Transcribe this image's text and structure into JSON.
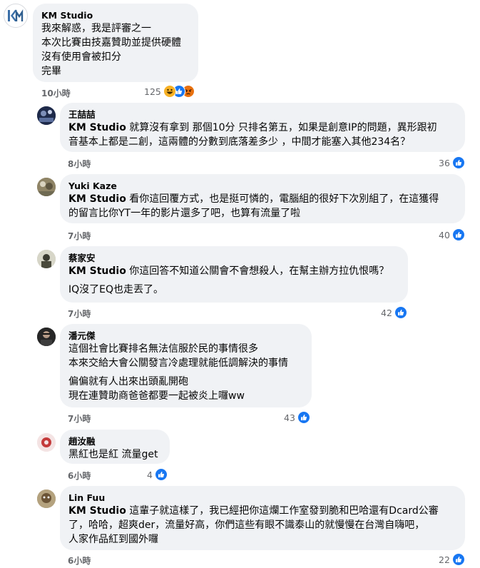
{
  "comments": [
    {
      "author": "KM Studio",
      "text_lines": [
        "我來解惑，我是評審之一",
        "本次比賽由技嘉贊助並提供硬體",
        "沒有使用會被扣分",
        "完畢"
      ],
      "time": "10小時",
      "reaction_count": "125",
      "reactions": [
        "haha-icon",
        "like-icon",
        "angry-icon"
      ]
    },
    {
      "author": "王喆喆",
      "mention": "KM Studio",
      "text_lines": [
        " 就算沒有拿到 那個10分 只排名第五，如果是創意IP的問題，異形跟初",
        "音基本上都是二創，這兩體的分數到底落差多少 ，中間才能塞入其他234名？"
      ],
      "time": "8小時",
      "reaction_count": "36",
      "reactions": [
        "like-icon"
      ]
    },
    {
      "author": "Yuki Kaze",
      "mention": "KM Studio",
      "text_lines": [
        " 看你這回覆方式，也是挺可憐的，電腦組的很好下次別組了，在這獲得",
        "的留言比你YT一年的影片還多了吧，也算有流量了啦"
      ],
      "time": "7小時",
      "reaction_count": "40",
      "reactions": [
        "like-icon"
      ]
    },
    {
      "author": "蔡家安",
      "mention": "KM Studio",
      "text_lines": [
        " 你這回答不知道公關會不會想殺人，在幫主辦方拉仇恨嗎？",
        "IQ沒了EQ也走丟了。"
      ],
      "time": "7小時",
      "reaction_count": "42",
      "reactions": [
        "like-icon"
      ]
    },
    {
      "author": "潘元傑",
      "text_lines": [
        "這個社會比賽排名無法信服於民的事情很多",
        "本來交給大會公關發言冷處理就能低調解決的事情",
        "偏偏就有人出來出頭亂開砲",
        "現在連贊助商爸爸都要一起被炎上囉ww"
      ],
      "time": "7小時",
      "reaction_count": "43",
      "reactions": [
        "like-icon"
      ]
    },
    {
      "author": "趙汝融",
      "text_lines": [
        "黑紅也是紅 流量get"
      ],
      "time": "6小時",
      "reaction_count": "4",
      "reactions": [
        "like-icon"
      ]
    },
    {
      "author": "Lin Fuu",
      "mention": "KM Studio",
      "text_lines": [
        " 這輩子就這樣了，我已經把你這爛工作室發到脆和巴哈還有Dcard公審",
        "了，哈哈，超爽der，流量好高，你們這些有眼不識泰山的就慢慢在台灣自嗨吧，",
        "人家作品紅到國外囉"
      ],
      "time": "6小時",
      "reaction_count": "22",
      "reactions": [
        "like-icon"
      ]
    }
  ],
  "colors": {
    "bubble_bg": "#f0f2f5",
    "meta_text": "#65676b",
    "like_blue": "#1877f2",
    "haha_yellow": "#f7b125",
    "angry_orange": "#e9710f"
  }
}
